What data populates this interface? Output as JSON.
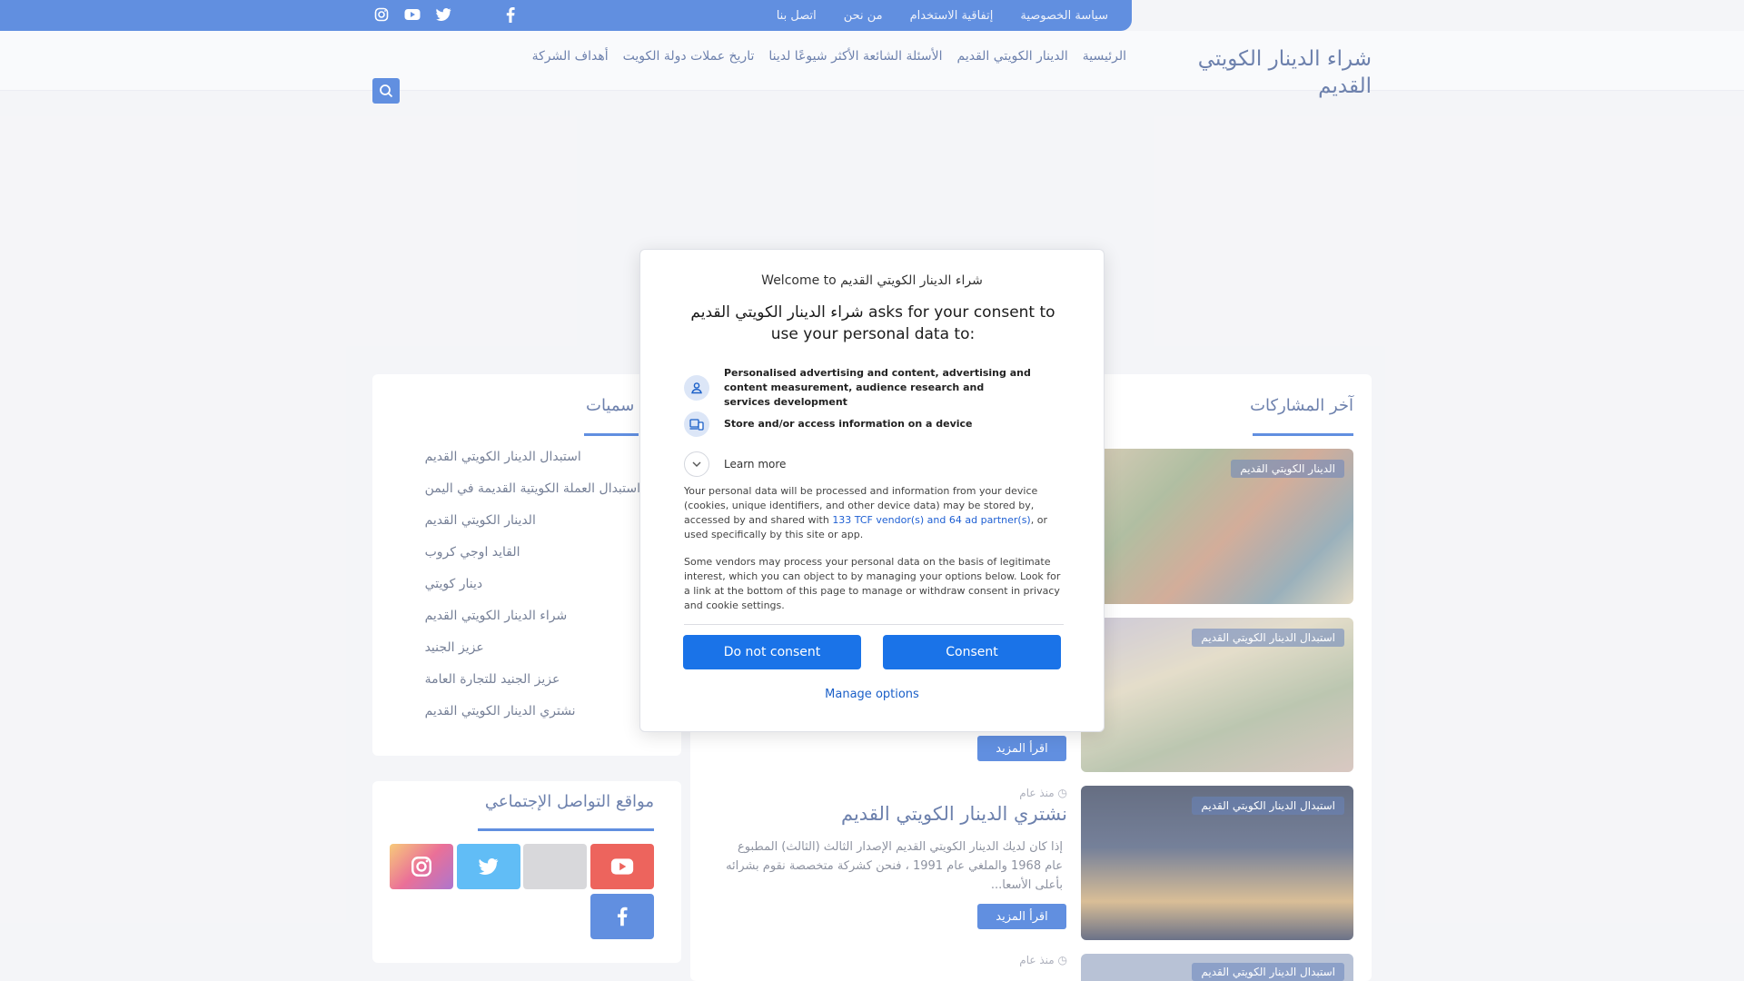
{
  "top_links": [
    "سياسة الخصوصية",
    "إتفاقية الاستخدام",
    "من نحن",
    "اتصل بنا"
  ],
  "site_title": "شراء الدينار الكويتي القديم",
  "nav": [
    "الرئيسية",
    "الدينار الكويتي القديم",
    "الأسئلة الشائعة الأكثر شيوعًا لدينا",
    "تاريخ عملات دولة الكويت",
    "أهداف الشركة"
  ],
  "latest": {
    "title": "آخر المشاركات",
    "badges": [
      "الدينار الكويتي القديم",
      "استبدال الدينار الكويتي القديم",
      "استبدال الدينار الكويتي القديم",
      "استبدال الدينار الكويتي القديم"
    ],
    "read_more": "اقرأ المزيد",
    "post": {
      "meta": "منذ عام",
      "title": "نشتري الدينار الكويتي القديم",
      "excerpt": "إذا كان لديك الدينار الكويتي القديم الإصدار الثالث (الثالث) المطبوع عام 1968 والملغي عام 1991 ، فنحن كشركة متخصصة نقوم بشرائه بأعلى الأسعا..."
    },
    "post2_meta": "منذ عام"
  },
  "categories": {
    "title": "التسميات",
    "title_visible": "سميات",
    "items": [
      "استبدال الدينار الكويتي القديم",
      "استبدال العملة الكويتية القديمة في اليمن",
      "الدينار الكويتي القديم",
      "القايد اوجي كروب",
      "دينار كويتي",
      "شراء الدينار الكويتي القديم",
      "عزيز الجنيد",
      "عزيز الجنيد للتجارة العامة",
      "نشتري الدينار الكويتي القديم"
    ]
  },
  "social_section": {
    "title": "مواقع التواصل الإجتماعي"
  },
  "consent": {
    "welcome": "Welcome to شراء الدينار الكويتي القديم",
    "heading": "شراء الدينار الكويتي القديم asks for your consent to use your personal data to:",
    "purposes": [
      {
        "icon": "person-icon",
        "text": "Personalised advertising and content, advertising and content measurement, audience research and services development"
      },
      {
        "icon": "device-icon",
        "text": "Store and/or access information on a device"
      }
    ],
    "learn_more": "Learn more",
    "para1_a": "Your personal data will be processed and information from your device (cookies, unique identifiers, and other device data) may be stored by, accessed by and shared with ",
    "para1_link": "133 TCF vendor(s) and 64 ad partner(s)",
    "para1_b": ", or used specifically by this site or app.",
    "para2": "Some vendors may process your personal data on the basis of legitimate interest, which you can object to by managing your options below. Look for a link at the bottom of this page to manage or withdraw consent in privacy and cookie settings.",
    "do_not_consent": "Do not consent",
    "consent": "Consent",
    "manage": "Manage options"
  },
  "colors": {
    "accent": "#1e5fd3",
    "button": "#1a73e8"
  }
}
